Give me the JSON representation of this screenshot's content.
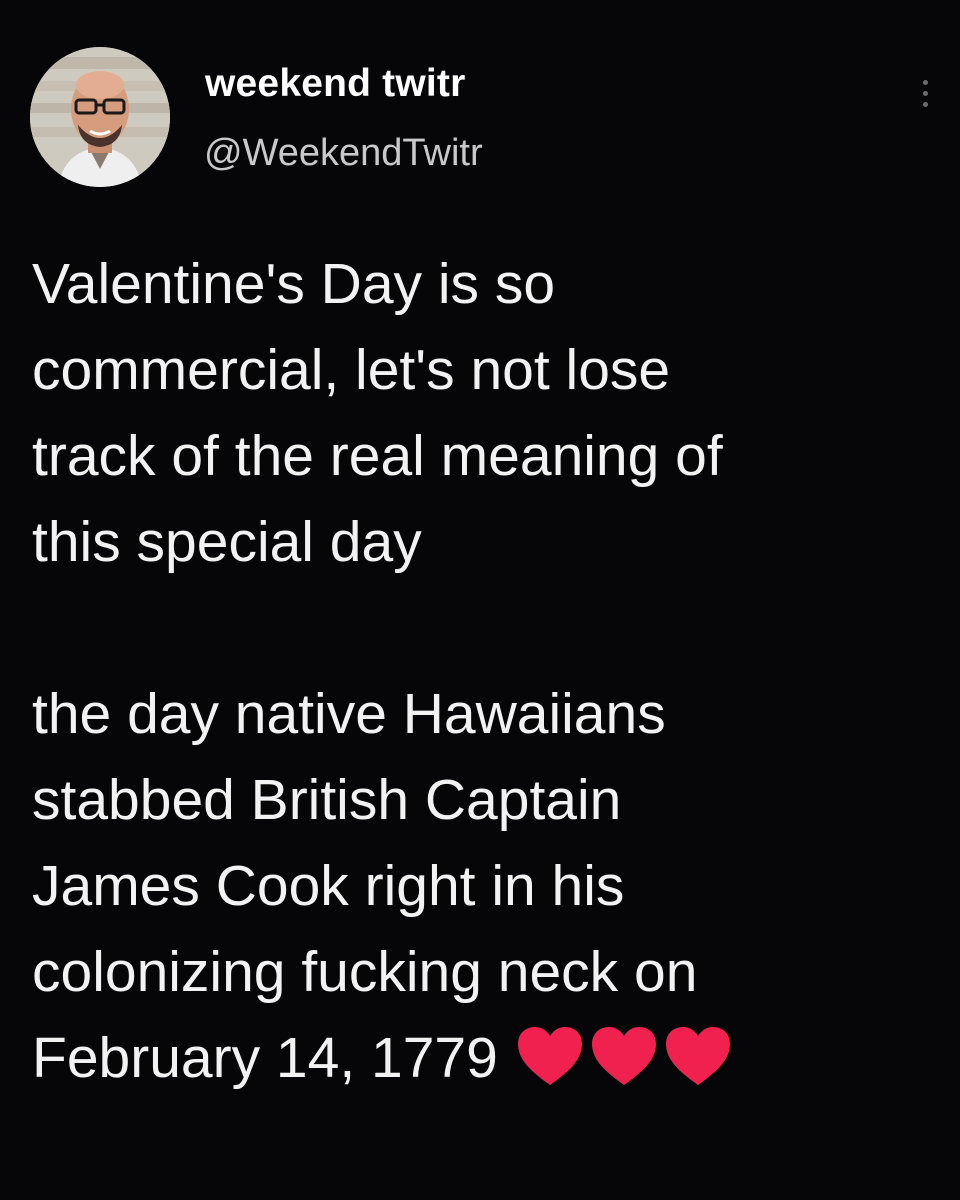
{
  "tweet": {
    "author": {
      "display_name": "weekend twitr",
      "handle": "@WeekendTwitr",
      "avatar_icon": "bald-man-with-glasses-avatar"
    },
    "more_menu_icon": "vertical-ellipsis-icon",
    "text_part1": "Valentine's Day is so\ncommercial, let's not lose\ntrack of the real meaning of\nthis special day\n\nthe day native Hawaiians\nstabbed British Captain\nJames Cook right in his\ncolonizing fucking neck on\nFebruary 14, 1779",
    "emoji": [
      "red-heart-icon",
      "red-heart-icon",
      "red-heart-icon"
    ],
    "colors": {
      "background": "#060608",
      "text": "#f2f2f2",
      "handle": "#c9c9cc",
      "heart": "#f0204f"
    }
  }
}
